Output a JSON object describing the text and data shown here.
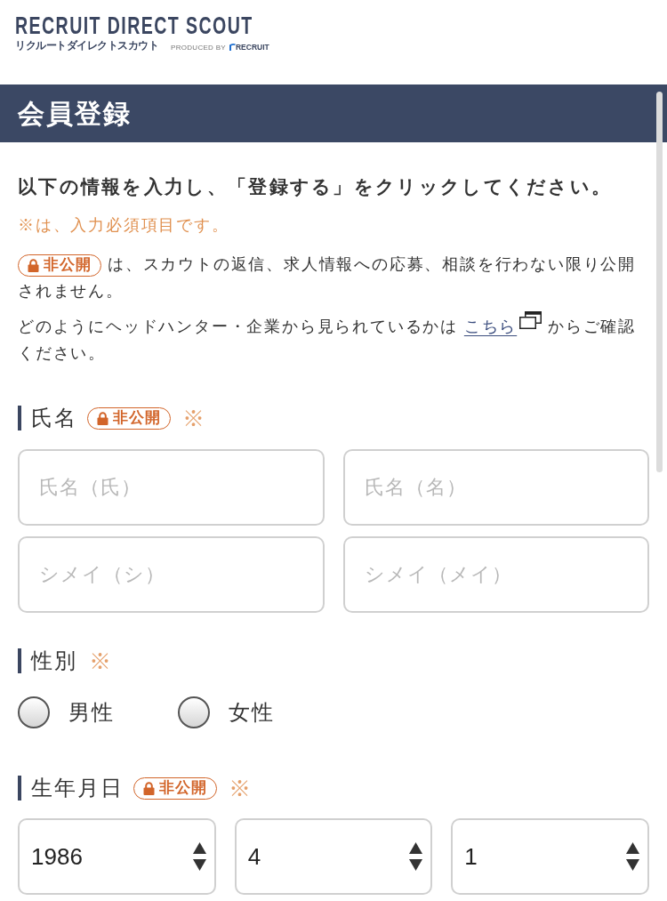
{
  "header": {
    "logo_title": "RECRUIT DIRECT SCOUT",
    "logo_subtitle": "リクルートダイレクトスカウト",
    "produced_by": "PRODUCED BY",
    "produced_by_brand": "RECRUIT"
  },
  "page_title": "会員登録",
  "intro": {
    "instruction": "以下の情報を入力し、「登録する」をクリックしてください。",
    "required_note": "※は、入力必須項目です。",
    "private_badge": "非公開",
    "private_note": "は、スカウトの返信、求人情報への応募、相談を行わない限り公開されません。",
    "view_note_before": "どのようにヘッドハンター・企業から見られているかは",
    "view_link": "こちら",
    "view_note_after": "からご確認ください。"
  },
  "sections": [
    {
      "kind": "text_fields",
      "label": "氏名",
      "private_badge": "非公開",
      "required_mark": "※",
      "fields": [
        {
          "placeholder": "氏名（氏）"
        },
        {
          "placeholder": "氏名（名）"
        },
        {
          "placeholder": "シメイ（シ）"
        },
        {
          "placeholder": "シメイ（メイ）"
        }
      ]
    },
    {
      "kind": "radio",
      "label": "性別",
      "required_mark": "※",
      "options": [
        {
          "label": "男性",
          "selected": false
        },
        {
          "label": "女性",
          "selected": false
        }
      ]
    },
    {
      "kind": "selects",
      "label": "生年月日",
      "private_badge": "非公開",
      "required_mark": "※",
      "selects": [
        {
          "value": "1986"
        },
        {
          "value": "4"
        },
        {
          "value": "1"
        }
      ]
    }
  ]
}
